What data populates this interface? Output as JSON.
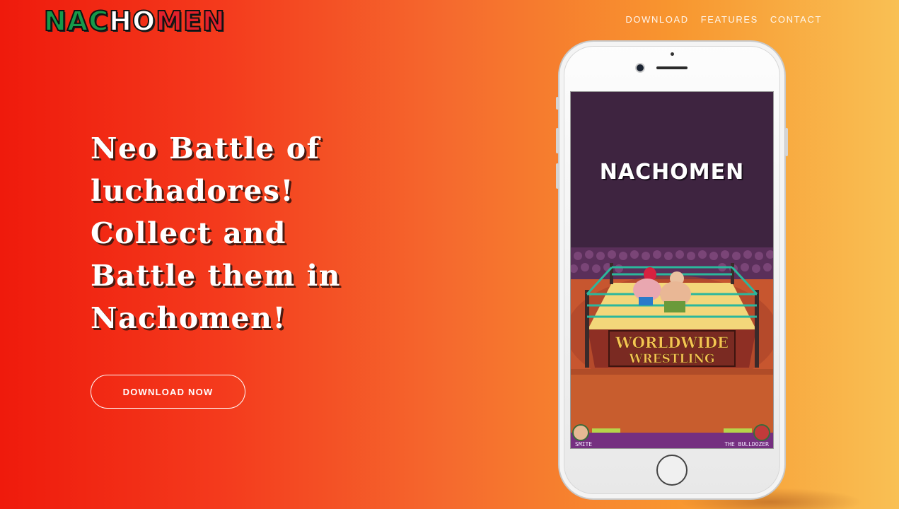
{
  "brand": {
    "logo_letters": [
      "N",
      "A",
      "C",
      "H",
      "O",
      "M",
      "E",
      "N"
    ],
    "logo_colors": [
      "#169a4a",
      "#169a4a",
      "#169a4a",
      "#ffffff",
      "#ffffff",
      "#e3202b",
      "#e3202b",
      "#e3202b"
    ]
  },
  "nav": {
    "items": [
      {
        "label": "DOWNLOAD"
      },
      {
        "label": "FEATURES"
      },
      {
        "label": "CONTACT"
      }
    ]
  },
  "hero": {
    "headline_lines": [
      "Neo Battle of",
      "luchadores!",
      "Collect and",
      "Battle them in",
      "Nachomen!"
    ],
    "cta_label": "DOWNLOAD NOW"
  },
  "phone": {
    "game": {
      "title": "NACHOMEN",
      "ring_banner_line1": "WORLDWIDE",
      "ring_banner_line2": "WRESTLING",
      "player_left_name": "SMITE",
      "player_right_name": "THE BULLDOZER",
      "background_color": "#3e2440"
    }
  },
  "colors": {
    "gradient_left": "#ef1a0c",
    "gradient_right": "#f9c054",
    "text": "#ffffff"
  }
}
